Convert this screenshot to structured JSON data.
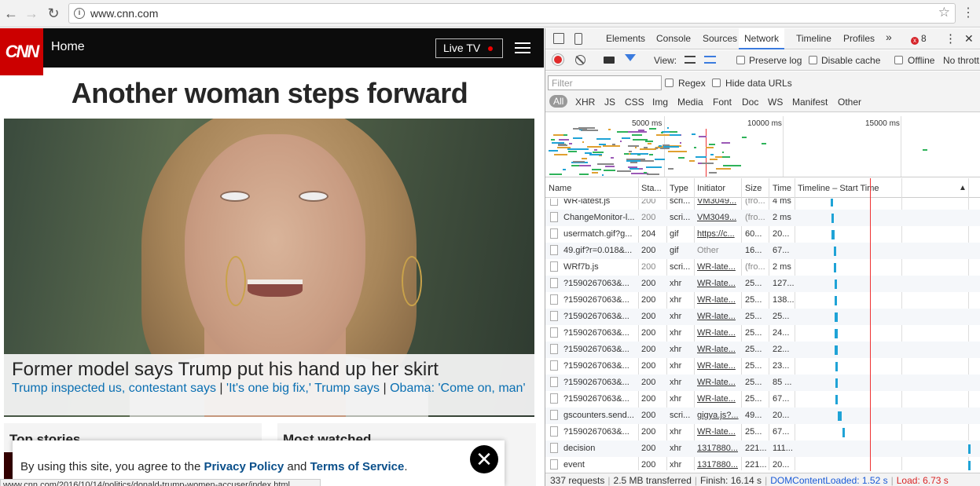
{
  "browser": {
    "url": "www.cnn.com",
    "back_icon": "←",
    "forward_icon": "→",
    "reload_icon": "↻",
    "info_icon": "i",
    "star_icon": "☆",
    "menu_icon": "⋮"
  },
  "cnn": {
    "logo": "CNN",
    "nav_home": "Home",
    "live_tv": "Live TV",
    "headline": "Another woman steps forward",
    "caption_title": "Former model says Trump put his hand up her skirt",
    "caption_link1": "Trump inspected us, contestant says",
    "caption_link2": "'It's one big fix,' Trump says",
    "caption_link3": "Obama: 'Come on, man'",
    "caption_sep": " | ",
    "top_stories": "Top stories",
    "most_watched": "Most watched",
    "consent_prefix": "By using this site, you agree to the ",
    "consent_privacy": "Privacy Policy",
    "consent_and": " and ",
    "consent_terms": "Terms of Service",
    "consent_period": ".",
    "consent_close": "✕",
    "status_url": "www.cnn.com/2016/10/14/politics/donald-trump-women-accuser/index.html"
  },
  "devtools": {
    "tabs": [
      "Elements",
      "Console",
      "Sources",
      "Network",
      "Timeline",
      "Profiles"
    ],
    "active_tab": "Network",
    "more_tabs": "»",
    "error_count": "8",
    "more_menu": "⋮",
    "close": "✕",
    "toolbar": {
      "view_label": "View:",
      "preserve_log": "Preserve log",
      "disable_cache": "Disable cache",
      "offline": "Offline",
      "throttling": "No thrott"
    },
    "filter": {
      "placeholder": "Filter",
      "regex": "Regex",
      "hide_data_urls": "Hide data URLs"
    },
    "types": [
      "All",
      "XHR",
      "JS",
      "CSS",
      "Img",
      "Media",
      "Font",
      "Doc",
      "WS",
      "Manifest",
      "Other"
    ],
    "overview_ticks": [
      "5000 ms",
      "10000 ms",
      "15000 ms"
    ],
    "columns": {
      "name": "Name",
      "status": "Sta...",
      "type": "Type",
      "initiator": "Initiator",
      "size": "Size",
      "time": "Time",
      "timeline": "Timeline – Start Time",
      "sort_icon": "▲"
    },
    "rows": [
      {
        "name": "WR-latest.js",
        "status": "200",
        "type": "scri...",
        "initiator": "VM3049...",
        "size": "(fro...",
        "time": "4 ms",
        "bar_start": 0.19,
        "bar_width": 0.01,
        "init_link": true,
        "status_dim": true,
        "size_dim": true
      },
      {
        "name": "ChangeMonitor-l...",
        "status": "200",
        "type": "scri...",
        "initiator": "VM3049...",
        "size": "(fro...",
        "time": "2 ms",
        "bar_start": 0.195,
        "bar_width": 0.01,
        "init_link": true,
        "status_dim": true,
        "size_dim": true
      },
      {
        "name": "usermatch.gif?g...",
        "status": "204",
        "type": "gif",
        "initiator": "https://c...",
        "size": "60...",
        "time": "20...",
        "bar_start": 0.195,
        "bar_width": 0.02,
        "init_link": true,
        "status_dim": false,
        "size_dim": false
      },
      {
        "name": "49.gif?r=0.018&...",
        "status": "200",
        "type": "gif",
        "initiator": "Other",
        "size": "16...",
        "time": "67...",
        "bar_start": 0.21,
        "bar_width": 0.015,
        "init_link": false,
        "status_dim": false,
        "size_dim": false
      },
      {
        "name": "WRf7b.js",
        "status": "200",
        "type": "scri...",
        "initiator": "WR-late...",
        "size": "(fro...",
        "time": "2 ms",
        "bar_start": 0.21,
        "bar_width": 0.01,
        "init_link": true,
        "status_dim": true,
        "size_dim": true
      },
      {
        "name": "?1590267063&...",
        "status": "200",
        "type": "xhr",
        "initiator": "WR-late...",
        "size": "25...",
        "time": "127...",
        "bar_start": 0.212,
        "bar_width": 0.01,
        "init_link": true,
        "status_dim": false,
        "size_dim": false
      },
      {
        "name": "?1590267063&...",
        "status": "200",
        "type": "xhr",
        "initiator": "WR-late...",
        "size": "25...",
        "time": "138...",
        "bar_start": 0.214,
        "bar_width": 0.01,
        "init_link": true,
        "status_dim": false,
        "size_dim": false
      },
      {
        "name": "?1590267063&...",
        "status": "200",
        "type": "xhr",
        "initiator": "WR-late...",
        "size": "25...",
        "time": "25...",
        "bar_start": 0.214,
        "bar_width": 0.02,
        "init_link": true,
        "status_dim": false,
        "size_dim": false
      },
      {
        "name": "?1590267063&...",
        "status": "200",
        "type": "xhr",
        "initiator": "WR-late...",
        "size": "25...",
        "time": "24...",
        "bar_start": 0.214,
        "bar_width": 0.02,
        "init_link": true,
        "status_dim": false,
        "size_dim": false
      },
      {
        "name": "?1590267063&...",
        "status": "200",
        "type": "xhr",
        "initiator": "WR-late...",
        "size": "25...",
        "time": "22...",
        "bar_start": 0.214,
        "bar_width": 0.018,
        "init_link": true,
        "status_dim": false,
        "size_dim": false
      },
      {
        "name": "?1590267063&...",
        "status": "200",
        "type": "xhr",
        "initiator": "WR-late...",
        "size": "25...",
        "time": "23...",
        "bar_start": 0.216,
        "bar_width": 0.018,
        "init_link": true,
        "status_dim": false,
        "size_dim": false
      },
      {
        "name": "?1590267063&...",
        "status": "200",
        "type": "xhr",
        "initiator": "WR-late...",
        "size": "25...",
        "time": "85 ...",
        "bar_start": 0.218,
        "bar_width": 0.01,
        "init_link": true,
        "status_dim": false,
        "size_dim": false
      },
      {
        "name": "?1590267063&...",
        "status": "200",
        "type": "xhr",
        "initiator": "WR-late...",
        "size": "25...",
        "time": "67...",
        "bar_start": 0.218,
        "bar_width": 0.01,
        "init_link": true,
        "status_dim": false,
        "size_dim": false
      },
      {
        "name": "gscounters.send...",
        "status": "200",
        "type": "scri...",
        "initiator": "gigya.js?...",
        "size": "49...",
        "time": "20...",
        "bar_start": 0.23,
        "bar_width": 0.025,
        "init_link": true,
        "status_dim": false,
        "size_dim": false
      },
      {
        "name": "?1590267063&...",
        "status": "200",
        "type": "xhr",
        "initiator": "WR-late...",
        "size": "25...",
        "time": "67...",
        "bar_start": 0.26,
        "bar_width": 0.01,
        "init_link": true,
        "status_dim": false,
        "size_dim": false
      },
      {
        "name": "decision",
        "status": "200",
        "type": "xhr",
        "initiator": "1317880...",
        "size": "221...",
        "time": "111...",
        "bar_start": 0.985,
        "bar_width": 0.015,
        "init_link": true,
        "status_dim": false,
        "size_dim": false
      },
      {
        "name": "event",
        "status": "200",
        "type": "xhr",
        "initiator": "1317880...",
        "size": "221...",
        "time": "20...",
        "bar_start": 0.985,
        "bar_width": 0.015,
        "init_link": true,
        "status_dim": false,
        "size_dim": false
      }
    ],
    "summary": {
      "requests": "337 requests",
      "transferred": "2.5 MB transferred",
      "finish": "Finish: 16.14 s",
      "dom": "DOMContentLoaded: 1.52 s",
      "load": "Load: 6.73 s"
    }
  }
}
